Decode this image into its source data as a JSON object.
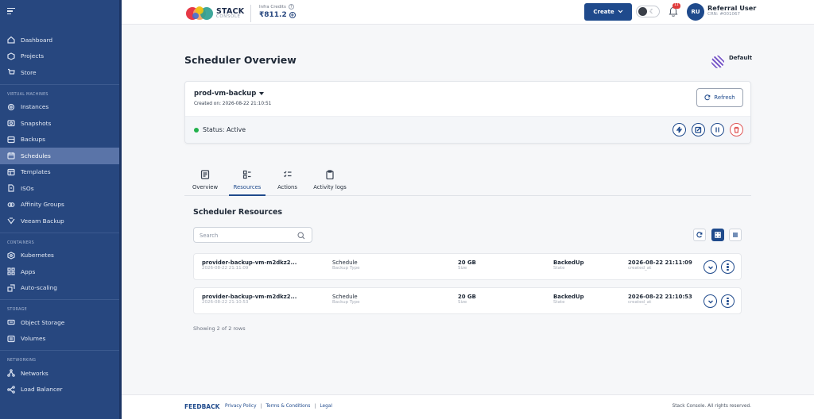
{
  "sidebar": {
    "items_top": [
      {
        "label": "Dashboard",
        "icon": "home-icon"
      },
      {
        "label": "Projects",
        "icon": "projects-icon"
      },
      {
        "label": "Store",
        "icon": "cart-icon"
      }
    ],
    "section_vm": "VIRTUAL MACHINES",
    "items_vm": [
      {
        "label": "Instances",
        "icon": "instances-icon"
      },
      {
        "label": "Snapshots",
        "icon": "snapshot-icon"
      },
      {
        "label": "Backups",
        "icon": "backup-icon"
      },
      {
        "label": "Schedules",
        "icon": "calendar-icon",
        "active": true
      },
      {
        "label": "Templates",
        "icon": "template-icon"
      },
      {
        "label": "ISOs",
        "icon": "iso-icon"
      },
      {
        "label": "Affinity Groups",
        "icon": "affinity-icon"
      },
      {
        "label": "Veeam Backup",
        "icon": "veeam-icon"
      }
    ],
    "section_containers": "CONTAINERS",
    "items_containers": [
      {
        "label": "Kubernetes",
        "icon": "kubernetes-icon"
      },
      {
        "label": "Apps",
        "icon": "apps-icon"
      },
      {
        "label": "Auto-scaling",
        "icon": "autoscale-icon"
      }
    ],
    "section_storage": "STORAGE",
    "items_storage": [
      {
        "label": "Object Storage",
        "icon": "object-storage-icon"
      },
      {
        "label": "Volumes",
        "icon": "volumes-icon"
      }
    ],
    "section_networking": "NETWORKING",
    "items_networking": [
      {
        "label": "Networks",
        "icon": "network-icon"
      },
      {
        "label": "Load Balancer",
        "icon": "load-balancer-icon"
      }
    ]
  },
  "header": {
    "logo_line1": "STACK",
    "logo_line2": "CONSOLE",
    "credits_label": "Infra Credits",
    "credits_value": "₹811.2",
    "create_label": "Create",
    "notification_count": "11",
    "avatar_initials": "RU",
    "user_name": "Referral User",
    "user_crn": "CRN: #001067"
  },
  "page": {
    "title": "Scheduler Overview",
    "project_badge": "Default"
  },
  "schedule_card": {
    "name": "prod-vm-backup",
    "created": "Created on: 2026-08-22 21:10:51",
    "refresh_label": "Refresh",
    "status": "Status: Active"
  },
  "tabs": [
    {
      "label": "Overview"
    },
    {
      "label": "Resources",
      "active": true
    },
    {
      "label": "Actions"
    },
    {
      "label": "Activity logs"
    }
  ],
  "resources": {
    "title": "Scheduler Resources",
    "search_placeholder": "Search",
    "rows": [
      {
        "name": "provider-backup-vm-m2dkz2...",
        "date": "2026-08-22 21:11:09",
        "type": "Schedule",
        "type_label": "Backup Type",
        "size": "20 GB",
        "size_label": "Size",
        "state": "BackedUp",
        "state_label": "State",
        "created_at": "2026-08-22 21:11:09",
        "created_label": "created_at"
      },
      {
        "name": "provider-backup-vm-m2dkz2...",
        "date": "2026-08-22 21:10:53",
        "type": "Schedule",
        "type_label": "Backup Type",
        "size": "20 GB",
        "size_label": "Size",
        "state": "BackedUp",
        "state_label": "State",
        "created_at": "2026-08-22 21:10:53",
        "created_label": "created_at"
      }
    ],
    "showing": "Showing 2 of 2 rows"
  },
  "footer": {
    "feedback": "FEEDBACK",
    "privacy": "Privacy Policy",
    "terms": "Terms & Conditions",
    "legal": "Legal",
    "copyright": "Stack Console. All rights reserved."
  },
  "colors": {
    "sidebar_bg": "#27477f",
    "accent": "#1f4a8c",
    "status_active": "#22b14c",
    "danger": "#e05757"
  }
}
